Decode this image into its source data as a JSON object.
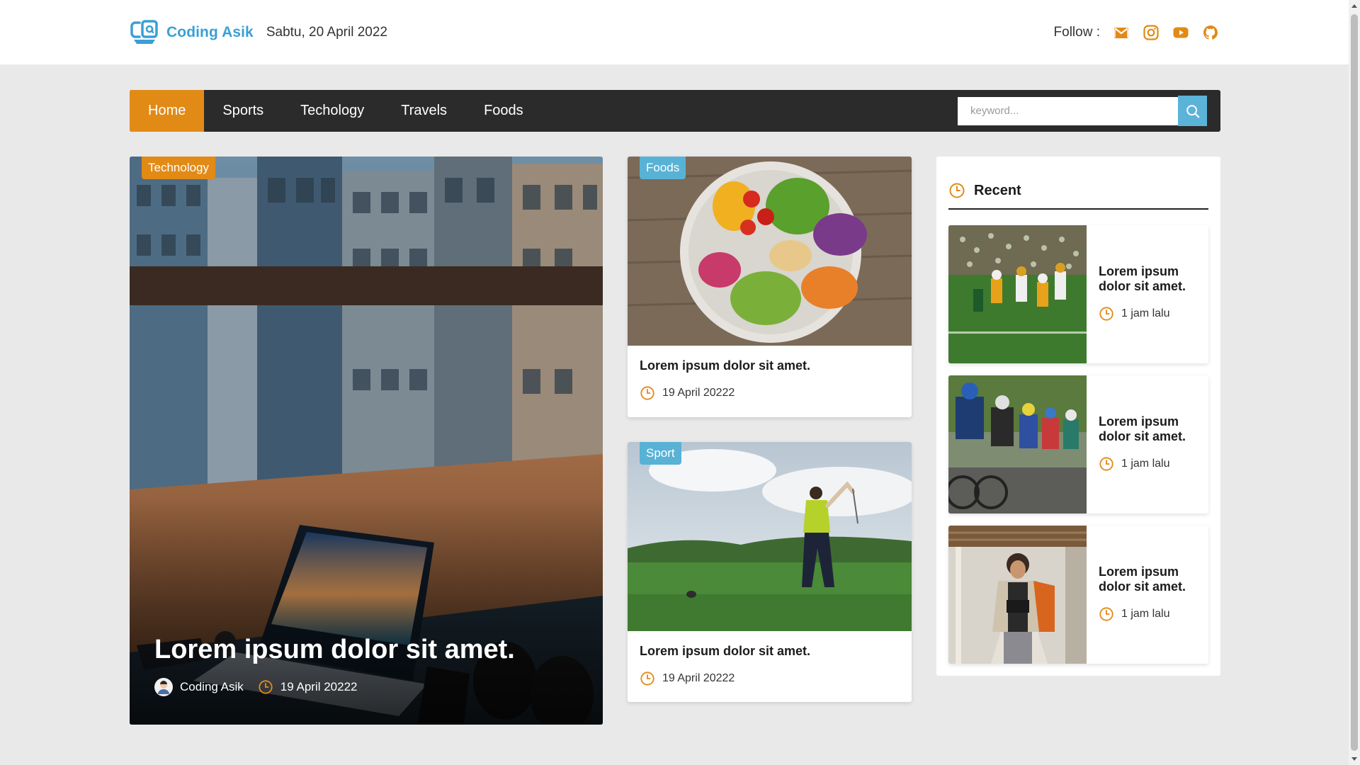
{
  "brand": {
    "logo_text": "Coding Asik",
    "date": "Sabtu, 20 April 2022",
    "logo_color": "#3a9fd6"
  },
  "follow": {
    "label": "Follow :",
    "icons": [
      "gmail-icon",
      "instagram-icon",
      "youtube-icon",
      "github-icon"
    ]
  },
  "nav": {
    "items": [
      {
        "label": "Home",
        "active": true
      },
      {
        "label": "Sports",
        "active": false
      },
      {
        "label": "Techology",
        "active": false
      },
      {
        "label": "Travels",
        "active": false
      },
      {
        "label": "Foods",
        "active": false
      }
    ],
    "search_placeholder": "keyword...",
    "active_color": "#e28a16",
    "bar_color": "#2b2b2b"
  },
  "hero": {
    "badge": "Technology",
    "title": "Lorem ipsum dolor sit amet.",
    "author": "Coding Asik",
    "date": "19 April 20222"
  },
  "cards": [
    {
      "badge": "Foods",
      "title": "Lorem ipsum dolor sit amet.",
      "date": "19 April 20222"
    },
    {
      "badge": "Sport",
      "title": "Lorem ipsum dolor sit amet.",
      "date": "19 April 20222"
    }
  ],
  "recent": {
    "title": "Recent",
    "items": [
      {
        "title": "Lorem ipsum dolor sit amet.",
        "time": "1 jam lalu"
      },
      {
        "title": "Lorem ipsum dolor sit amet.",
        "time": "1 jam lalu"
      },
      {
        "title": "Lorem ipsum dolor sit amet.",
        "time": "1 jam lalu"
      }
    ]
  },
  "colors": {
    "accent_orange": "#e28a16",
    "accent_blue": "#58b2d6",
    "page_bg": "#e9e9e9"
  }
}
